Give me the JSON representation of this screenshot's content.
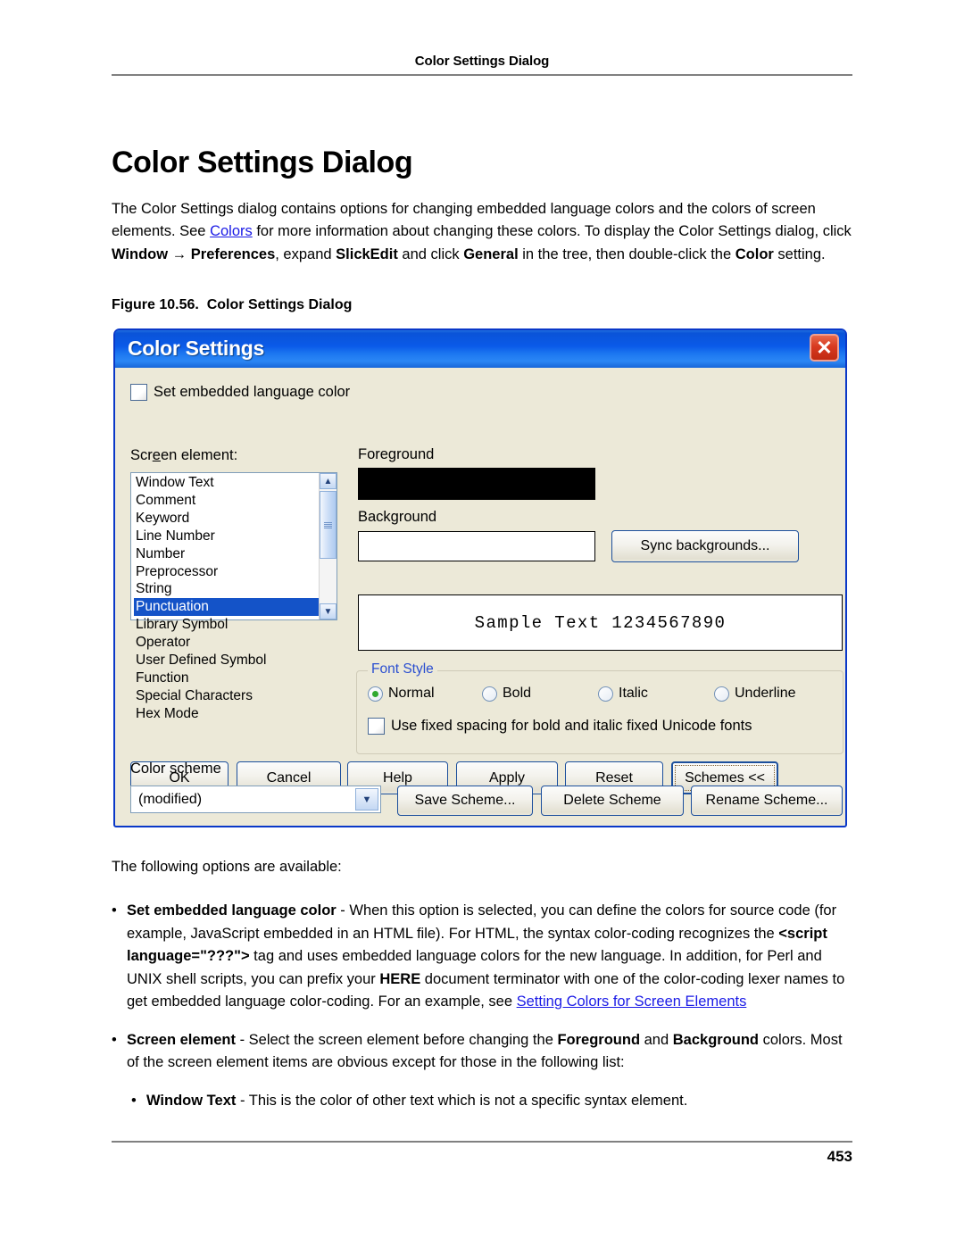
{
  "header": {
    "running_head": "Color Settings Dialog"
  },
  "title": "Color Settings Dialog",
  "intro": {
    "p1_a": "The Color Settings dialog contains options for changing embedded language colors and the colors of screen elements. See ",
    "link_colors": "Colors",
    "p1_b": " for more information about changing these colors. To display the Color Settings dialog, click ",
    "b_window": "Window",
    "arrow": " → ",
    "b_preferences": "Preferences",
    "p1_c": ", expand ",
    "b_slickedit": "SlickEdit",
    "p1_d": " and click ",
    "b_general": "General",
    "p1_e": " in the tree, then double-click the ",
    "b_color": "Color",
    "p1_f": " setting."
  },
  "figure": {
    "caption_label": "Figure 10.56.",
    "caption_text": "Color Settings Dialog"
  },
  "dialog": {
    "title": "Color Settings",
    "close_icon": "✕",
    "embedded_checkbox_label": "Set embedded language color",
    "screen_element_label_pre": "Scr",
    "screen_element_label_accel": "e",
    "screen_element_label_post": "en element:",
    "list_items": [
      "Window Text",
      "Comment",
      "Keyword",
      "Line Number",
      "Number",
      "Preprocessor",
      "String",
      "Punctuation",
      "Library Symbol",
      "Operator",
      "User Defined Symbol",
      "Function",
      "Special Characters",
      "Hex Mode"
    ],
    "selected_item": "Punctuation",
    "foreground_label": "Foreground",
    "background_label": "Background",
    "foreground_color": "#000000",
    "background_color": "#ffffff",
    "sync_backgrounds_button": "Sync backgrounds...",
    "sample_text": "Sample Text 1234567890",
    "font_style": {
      "legend": "Font Style",
      "options": [
        "Normal",
        "Bold",
        "Italic",
        "Underline"
      ],
      "selected": "Normal",
      "fixed_spacing_label": "Use fixed spacing for bold and italic fixed Unicode fonts",
      "fixed_spacing_checked": false
    },
    "buttons": {
      "ok": "OK",
      "cancel": "Cancel",
      "help": "Help",
      "apply": "Apply",
      "reset": "Reset",
      "schemes": "Schemes <<"
    },
    "color_scheme_label": "Color scheme",
    "color_scheme_value": "(modified)",
    "dropdown_icon": "⌄",
    "scheme_buttons": {
      "save": "Save Scheme...",
      "delete": "Delete Scheme",
      "rename": "Rename Scheme..."
    },
    "accent_titlebar": "#0a5ae8",
    "accent_selection": "#1453c8",
    "body_bg": "#ece9d8"
  },
  "after_figure": "The following options are available:",
  "bullets": {
    "b1_term": "Set embedded language color",
    "b1_a": " - When this option is selected, you can define the colors for source code (for example, JavaScript embedded in an HTML file). For HTML, the syntax color-coding recognizes the ",
    "b1_code": "<script language=\"???\">",
    "b1_b": " tag and uses embedded language colors for the new language. In addition, for Perl and UNIX shell scripts, you can prefix your ",
    "b1_here": "HERE",
    "b1_c": " document terminator with one of the color-coding lexer names to get embedded language color-coding. For an example, see ",
    "b1_link": "Setting Colors for Screen Elements",
    "b2_term": "Screen element",
    "b2_a": " - Select the screen element before changing the ",
    "b2_fg": "Foreground",
    "b2_b": " and ",
    "b2_bg": "Background",
    "b2_c": " colors. Most of the screen element items are obvious except for those in the following list:",
    "b3_term": "Window Text",
    "b3_a": " - This is the color of other text which is not a specific syntax element."
  },
  "page_number": "453"
}
